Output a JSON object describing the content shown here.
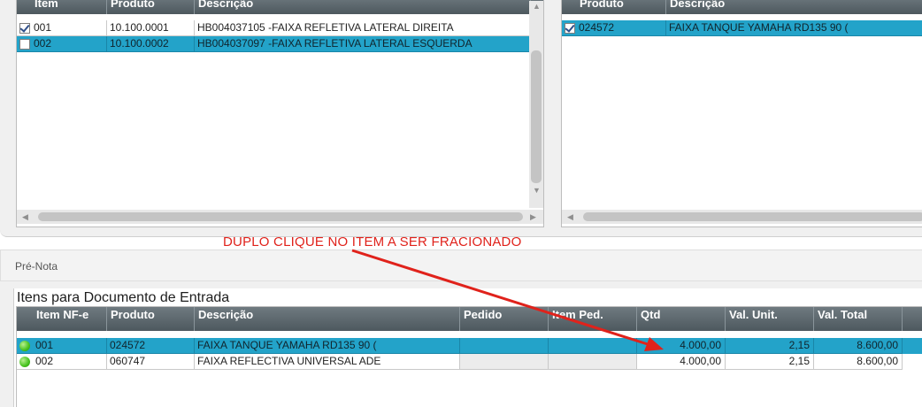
{
  "left_grid": {
    "columns": [
      "Item",
      "Produto",
      "Descrição"
    ],
    "rows": [
      {
        "checked": true,
        "item": "001",
        "produto": "10.100.0001",
        "descricao": "HB004037105 -FAIXA REFLETIVA LATERAL DIREITA",
        "selected": false
      },
      {
        "checked": false,
        "item": "002",
        "produto": "10.100.0002",
        "descricao": "HB004037097 -FAIXA REFLETIVA LATERAL ESQUERDA",
        "selected": true
      }
    ]
  },
  "right_grid": {
    "columns": [
      "Produto",
      "Descrição"
    ],
    "rows": [
      {
        "checked": true,
        "produto": "024572",
        "descricao": "FAIXA TANQUE YAMAHA RD135 90 (",
        "selected": true
      }
    ]
  },
  "annotation": {
    "text": "DUPLO CLIQUE NO ITEM A SER FRACIONADO",
    "color": "#e0221b"
  },
  "prenota": {
    "label": "Pré-Nota"
  },
  "items_section": {
    "title": "Itens para Documento de Entrada",
    "columns": [
      "Item NF-e",
      "Produto",
      "Descrição",
      "Pedido",
      "Item Ped.",
      "Qtd",
      "Val. Unit.",
      "Val. Total"
    ],
    "rows": [
      {
        "status": "green-dot-icon",
        "item_nfe": "001",
        "produto": "024572",
        "descricao": "FAIXA TANQUE YAMAHA RD135 90 (",
        "pedido": "",
        "item_ped": "",
        "qtd": "4.000,00",
        "val_unit": "2,15",
        "val_total": "8.600,00",
        "selected": true
      },
      {
        "status": "green-dot-icon",
        "item_nfe": "002",
        "produto": "060747",
        "descricao": "FAIXA REFLECTIVA UNIVERSAL ADE",
        "pedido": "",
        "item_ped": "",
        "qtd": "4.000,00",
        "val_unit": "2,15",
        "val_total": "8.600,00",
        "selected": false
      }
    ]
  },
  "colors": {
    "header": "#4d585e",
    "selected_row": "#23a3c9",
    "annotation": "#e0221b"
  }
}
